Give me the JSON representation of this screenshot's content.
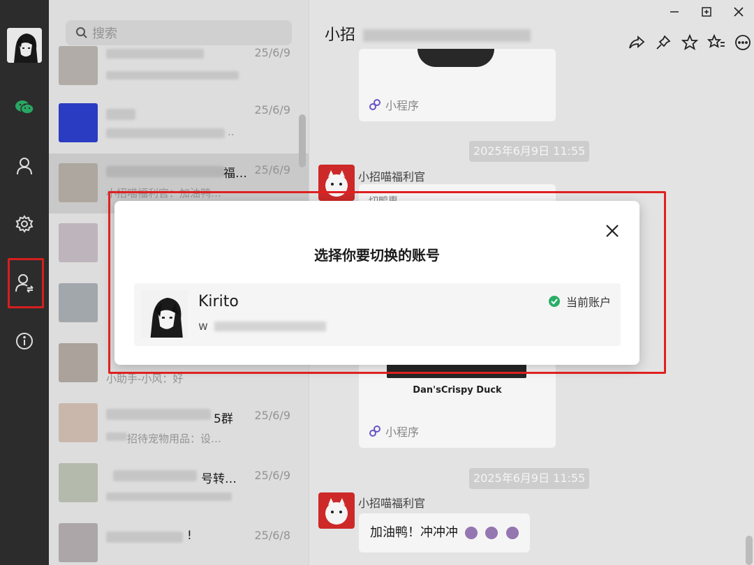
{
  "nav": {
    "icons": [
      "chat-icon",
      "contacts-icon",
      "settings-icon",
      "switch-account-icon",
      "info-icon"
    ],
    "accent": "#2aae67",
    "highlight": "#e02020"
  },
  "search": {
    "placeholder": "搜索"
  },
  "chats": [
    {
      "title": "",
      "time": "25/6/9",
      "sub": ""
    },
    {
      "title": "",
      "time": "25/6/9",
      "sub": ".."
    },
    {
      "title": "福…",
      "time": "25/6/9",
      "sub": "小招喵福利官：加油鸭…"
    },
    {
      "title": "",
      "time": "",
      "sub": ""
    },
    {
      "title": "",
      "time": "",
      "sub": ""
    },
    {
      "title": "",
      "time": "",
      "sub": "小助手-小风：好"
    },
    {
      "title": "5群",
      "time": "25/6/9",
      "sub": "招待宠物用品：设…"
    },
    {
      "title": "号转…",
      "time": "25/6/9",
      "sub": ""
    },
    {
      "title": "!",
      "time": "25/6/8",
      "sub": ""
    }
  ],
  "chat": {
    "title": "小招",
    "toolbar": [
      "share-icon",
      "pin-icon",
      "star-icon",
      "star-list-icon",
      "more-icon"
    ],
    "messages": {
      "mini_label_1": "小程序",
      "ts1": "2025年6月9日 11:55",
      "sender1": "小招喵福利官",
      "card2_top": "切鸭惠",
      "card2_brand": "Dan'sCrispy Duck",
      "mini_label_2": "小程序",
      "ts2": "2025年6月9日 11:55",
      "sender2": "小招喵福利官",
      "bubble": "加油鸭！冲冲冲"
    }
  },
  "modal": {
    "title": "选择你要切换的账号",
    "account": {
      "name": "Kirito",
      "wxid": "w",
      "status": "当前账户"
    },
    "status_color": "#2aae67"
  }
}
